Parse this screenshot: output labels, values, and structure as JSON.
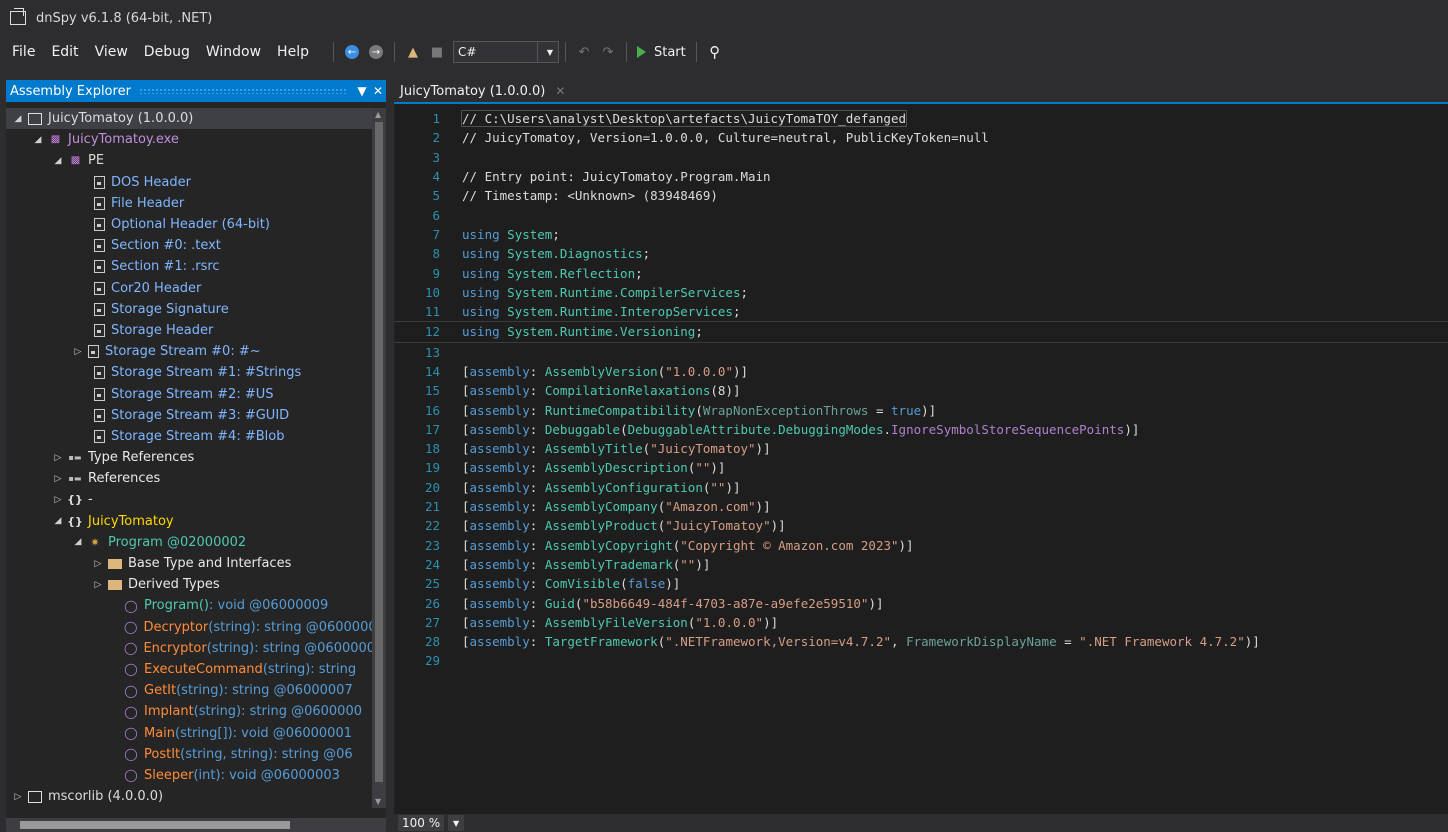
{
  "window": {
    "title": "dnSpy v6.1.8 (64-bit, .NET)"
  },
  "menu": [
    "File",
    "Edit",
    "View",
    "Debug",
    "Window",
    "Help"
  ],
  "toolbar": {
    "language": "C#",
    "start_label": "Start"
  },
  "explorer": {
    "title": "Assembly Explorer",
    "nodes": [
      {
        "label": "JuicyTomatoy (1.0.0.0)",
        "icon": "assembly-icon"
      },
      {
        "label": "JuicyTomatoy.exe",
        "icon": "module-icon"
      },
      {
        "label": "PE",
        "icon": "module-icon"
      },
      {
        "label": "DOS Header",
        "icon": "document-icon"
      },
      {
        "label": "File Header",
        "icon": "document-icon"
      },
      {
        "label": "Optional Header (64-bit)",
        "icon": "document-icon"
      },
      {
        "label": "Section #0: .text",
        "icon": "document-icon"
      },
      {
        "label": "Section #1: .rsrc",
        "icon": "document-icon"
      },
      {
        "label": "Cor20 Header",
        "icon": "document-icon"
      },
      {
        "label": "Storage Signature",
        "icon": "document-icon"
      },
      {
        "label": "Storage Header",
        "icon": "document-icon"
      },
      {
        "label": "Storage Stream #0: #~",
        "icon": "document-icon"
      },
      {
        "label": "Storage Stream #1: #Strings",
        "icon": "document-icon"
      },
      {
        "label": "Storage Stream #2: #US",
        "icon": "document-icon"
      },
      {
        "label": "Storage Stream #3: #GUID",
        "icon": "document-icon"
      },
      {
        "label": "Storage Stream #4: #Blob",
        "icon": "document-icon"
      },
      {
        "label": "Type References",
        "icon": "references-icon"
      },
      {
        "label": "References",
        "icon": "references-icon"
      },
      {
        "label": "-",
        "icon": "namespace-icon"
      },
      {
        "label": "JuicyTomatoy",
        "icon": "namespace-icon"
      },
      {
        "label": "Program @02000002",
        "icon": "class-icon"
      },
      {
        "label": "Base Type and Interfaces",
        "icon": "folder-icon"
      },
      {
        "label": "Derived Types",
        "icon": "folder-icon"
      },
      {
        "name": "Program()",
        "sig": " : void @06000009",
        "icon": "method-icon"
      },
      {
        "name": "Decryptor",
        "args": "(string)",
        "sig": " : string @0600000",
        "icon": "method-icon"
      },
      {
        "name": "Encryptor",
        "args": "(string)",
        "sig": " : string @0600000",
        "icon": "method-icon"
      },
      {
        "name": "ExecuteCommand",
        "args": "(string)",
        "sig": " : string",
        "icon": "method-icon"
      },
      {
        "name": "GetIt",
        "args": "(string)",
        "sig": " : string @06000007",
        "icon": "method-icon"
      },
      {
        "name": "Implant",
        "args": "(string)",
        "sig": " : string @0600000",
        "icon": "method-icon"
      },
      {
        "name": "Main",
        "args": "(string[])",
        "sig": " : void @06000001",
        "icon": "method-icon"
      },
      {
        "name": "PostIt",
        "args": "(string, string)",
        "sig": " : string @06",
        "icon": "method-icon"
      },
      {
        "name": "Sleeper",
        "args": "(int)",
        "sig": " : void @06000003",
        "icon": "method-icon"
      },
      {
        "label": "mscorlib (4.0.0.0)",
        "icon": "assembly-icon"
      }
    ]
  },
  "editor": {
    "tab_label": "JuicyTomatoy (1.0.0.0)",
    "zoom": "100 %",
    "lines": [
      "// C:\\Users\\analyst\\Desktop\\artefacts\\JuicyTomaTOY_defanged",
      "// JuicyTomatoy, Version=1.0.0.0, Culture=neutral, PublicKeyToken=null",
      "",
      "// Entry point: JuicyTomatoy.Program.Main",
      "// Timestamp: <Unknown> (83948469)",
      "",
      "using System;",
      "using System.Diagnostics;",
      "using System.Reflection;",
      "using System.Runtime.CompilerServices;",
      "using System.Runtime.InteropServices;",
      "using System.Runtime.Versioning;",
      "",
      "[assembly: AssemblyVersion(\"1.0.0.0\")]",
      "[assembly: CompilationRelaxations(8)]",
      "[assembly: RuntimeCompatibility(WrapNonExceptionThrows = true)]",
      "[assembly: Debuggable(DebuggableAttribute.DebuggingModes.IgnoreSymbolStoreSequencePoints)]",
      "[assembly: AssemblyTitle(\"JuicyTomatoy\")]",
      "[assembly: AssemblyDescription(\"\")]",
      "[assembly: AssemblyConfiguration(\"\")]",
      "[assembly: AssemblyCompany(\"Amazon.com\")]",
      "[assembly: AssemblyProduct(\"JuicyTomatoy\")]",
      "[assembly: AssemblyCopyright(\"Copyright © Amazon.com 2023\")]",
      "[assembly: AssemblyTrademark(\"\")]",
      "[assembly: ComVisible(false)]",
      "[assembly: Guid(\"b58b6649-484f-4703-a87e-a9efe2e59510\")]",
      "[assembly: AssemblyFileVersion(\"1.0.0.0\")]",
      "[assembly: TargetFramework(\".NETFramework,Version=v4.7.2\", FrameworkDisplayName = \".NET Framework 4.7.2\")]",
      ""
    ]
  }
}
